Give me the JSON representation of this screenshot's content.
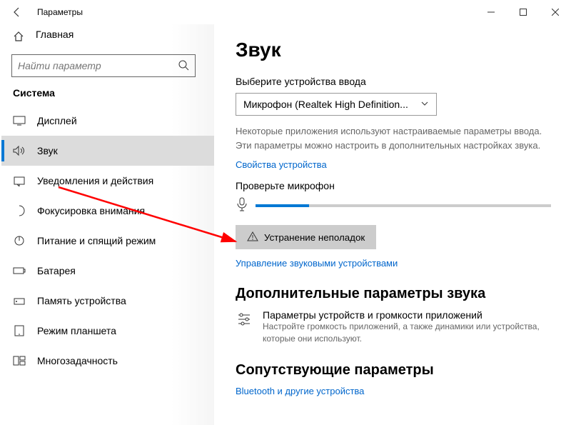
{
  "titlebar": {
    "title": "Параметры"
  },
  "sidebar": {
    "home": "Главная",
    "search_placeholder": "Найти параметр",
    "section": "Система",
    "items": [
      {
        "label": "Дисплей"
      },
      {
        "label": "Звук"
      },
      {
        "label": "Уведомления и действия"
      },
      {
        "label": "Фокусировка внимания"
      },
      {
        "label": "Питание и спящий режим"
      },
      {
        "label": "Батарея"
      },
      {
        "label": "Память устройства"
      },
      {
        "label": "Режим планшета"
      },
      {
        "label": "Многозадачность"
      }
    ]
  },
  "main": {
    "heading": "Звук",
    "input_label": "Выберите устройства ввода",
    "input_device": "Микрофон (Realtek High Definition...",
    "input_desc": "Некоторые приложения используют настраиваемые параметры ввода. Эти параметры можно настроить в дополнительных настройках звука.",
    "device_props": "Свойства устройства",
    "test_mic": "Проверьте микрофон",
    "mic_level_percent": 18,
    "troubleshoot": "Устранение неполадок",
    "manage_devices": "Управление звуковыми устройствами",
    "advanced_heading": "Дополнительные параметры звука",
    "app_vol_title": "Параметры устройств и громкости приложений",
    "app_vol_sub": "Настройте громкость приложений, а также динамики или устройства, которые они используют.",
    "related_heading": "Сопутствующие параметры",
    "bluetooth": "Bluetooth и другие устройства"
  }
}
